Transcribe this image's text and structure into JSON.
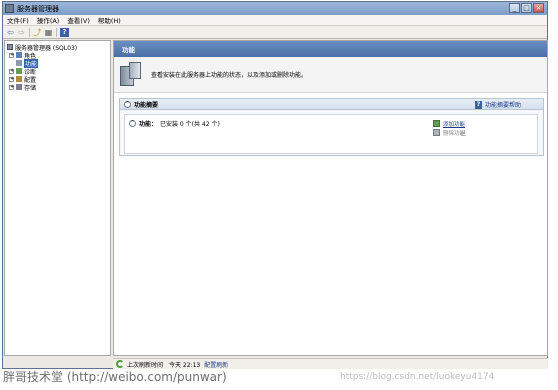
{
  "window": {
    "title": "服务器管理器",
    "buttons": [
      "_",
      "□",
      "×"
    ]
  },
  "menubar": {
    "items": [
      "文件(F)",
      "操作(A)",
      "查看(V)",
      "帮助(H)"
    ]
  },
  "toolbar": {
    "icons": [
      "back-icon",
      "forward-icon",
      "up-icon",
      "show-hide-tree-icon",
      "help-icon"
    ],
    "glyphs": [
      "⇦",
      "⇨",
      "⤴",
      "▦",
      "?"
    ]
  },
  "tree": {
    "root": "服务器管理器 (SQL03)",
    "items": [
      {
        "label": "角色",
        "expander": "+"
      },
      {
        "label": "功能",
        "expander": "",
        "selected": true
      },
      {
        "label": "诊断",
        "expander": "+"
      },
      {
        "label": "配置",
        "expander": "+"
      },
      {
        "label": "存储",
        "expander": "+"
      }
    ]
  },
  "content": {
    "header": "功能",
    "intro": "查看安装在此服务器上功能的状态，以及添加或删除功能。",
    "summary": {
      "title": "功能摘要",
      "help_link": "功能摘要帮助",
      "collapse_glyph": "^",
      "status_label": "功能：",
      "status_value": "已安装 0 个(共 42 个)",
      "actions": {
        "add": "添加功能",
        "remove": "删除功能"
      }
    }
  },
  "statusbar": {
    "last_refresh_label": "上次刷新时间",
    "last_refresh_value": "今天 22:13",
    "configure_link": "配置刷新"
  },
  "watermarks": {
    "left": "胖哥技术堂 (http://weibo.com/punwar)",
    "right": "https://blog.csdn.net/luokeyu4174"
  },
  "colors": {
    "header_blue": "#4a6ea6",
    "link_blue": "#1d3b8a",
    "selection": "#3363b3"
  }
}
